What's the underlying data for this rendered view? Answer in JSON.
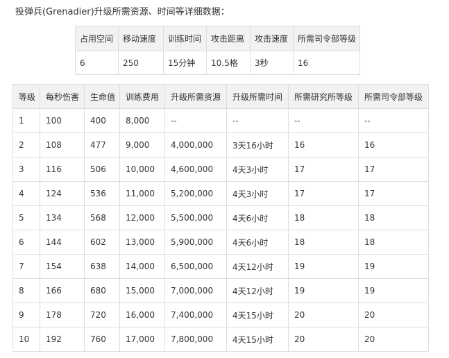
{
  "intro_text": "投弹兵(Grenadier)升级所需资源、时间等详细数据：",
  "summary": {
    "headers": [
      "占用空间",
      "移动速度",
      "训练时间",
      "攻击距离",
      "攻击速度",
      "所需司令部等级"
    ],
    "values": [
      "6",
      "250",
      "15分钟",
      "10.5格",
      "3秒",
      "16"
    ]
  },
  "levels": {
    "headers": [
      "等级",
      "每秒伤害",
      "生命值",
      "训练费用",
      "升级所需资源",
      "升级所需时间",
      "所需研究所等级",
      "所需司令部等级"
    ],
    "rows": [
      [
        "1",
        "100",
        "400",
        "8,000",
        "--",
        "--",
        "--",
        "--"
      ],
      [
        "2",
        "108",
        "477",
        "9,000",
        "4,000,000",
        "3天16小时",
        "16",
        "16"
      ],
      [
        "3",
        "116",
        "506",
        "10,000",
        "4,600,000",
        "4天3小时",
        "17",
        "17"
      ],
      [
        "4",
        "124",
        "536",
        "11,000",
        "5,200,000",
        "4天3小时",
        "17",
        "17"
      ],
      [
        "5",
        "134",
        "568",
        "12,000",
        "5,500,000",
        "4天6小时",
        "18",
        "18"
      ],
      [
        "6",
        "144",
        "602",
        "13,000",
        "5,900,000",
        "4天6小时",
        "18",
        "18"
      ],
      [
        "7",
        "154",
        "638",
        "14,000",
        "6,500,000",
        "4天12小时",
        "19",
        "19"
      ],
      [
        "8",
        "166",
        "680",
        "15,000",
        "7,000,000",
        "4天12小时",
        "19",
        "19"
      ],
      [
        "9",
        "178",
        "720",
        "16,000",
        "7,400,000",
        "4天15小时",
        "20",
        "20"
      ],
      [
        "10",
        "192",
        "760",
        "17,000",
        "7,800,000",
        "4天15小时",
        "20",
        "20"
      ]
    ]
  }
}
